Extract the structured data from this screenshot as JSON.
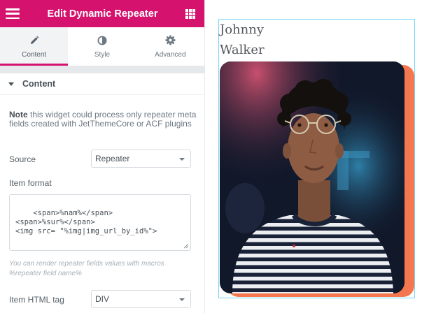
{
  "header": {
    "title": "Edit Dynamic Repeater"
  },
  "tabs": [
    {
      "label": "Content",
      "icon": "pencil-icon"
    },
    {
      "label": "Style",
      "icon": "contrast-icon"
    },
    {
      "label": "Advanced",
      "icon": "gear-icon"
    }
  ],
  "section": {
    "title": "Content"
  },
  "note": {
    "strong": "Note",
    "text": " this widget could process only repeater meta fields created with JetThemeCore or ACF plugins"
  },
  "source": {
    "label": "Source",
    "value": "Repeater"
  },
  "item_format": {
    "label": "Item format",
    "value": "<span>%nam%</span>\n<span>%sur%</span>\n<img src= \"%img|img_url_by_id%\">"
  },
  "hint": "You can render repeater fields values with macros %repeater field name%",
  "item_tag": {
    "label": "Item HTML tag",
    "value": "DIV"
  },
  "preview": {
    "first_name": "Johnny",
    "last_name": "Walker"
  },
  "colors": {
    "brand": "#d5136e",
    "accent": "#f4774f",
    "outline": "#71d7f7"
  }
}
